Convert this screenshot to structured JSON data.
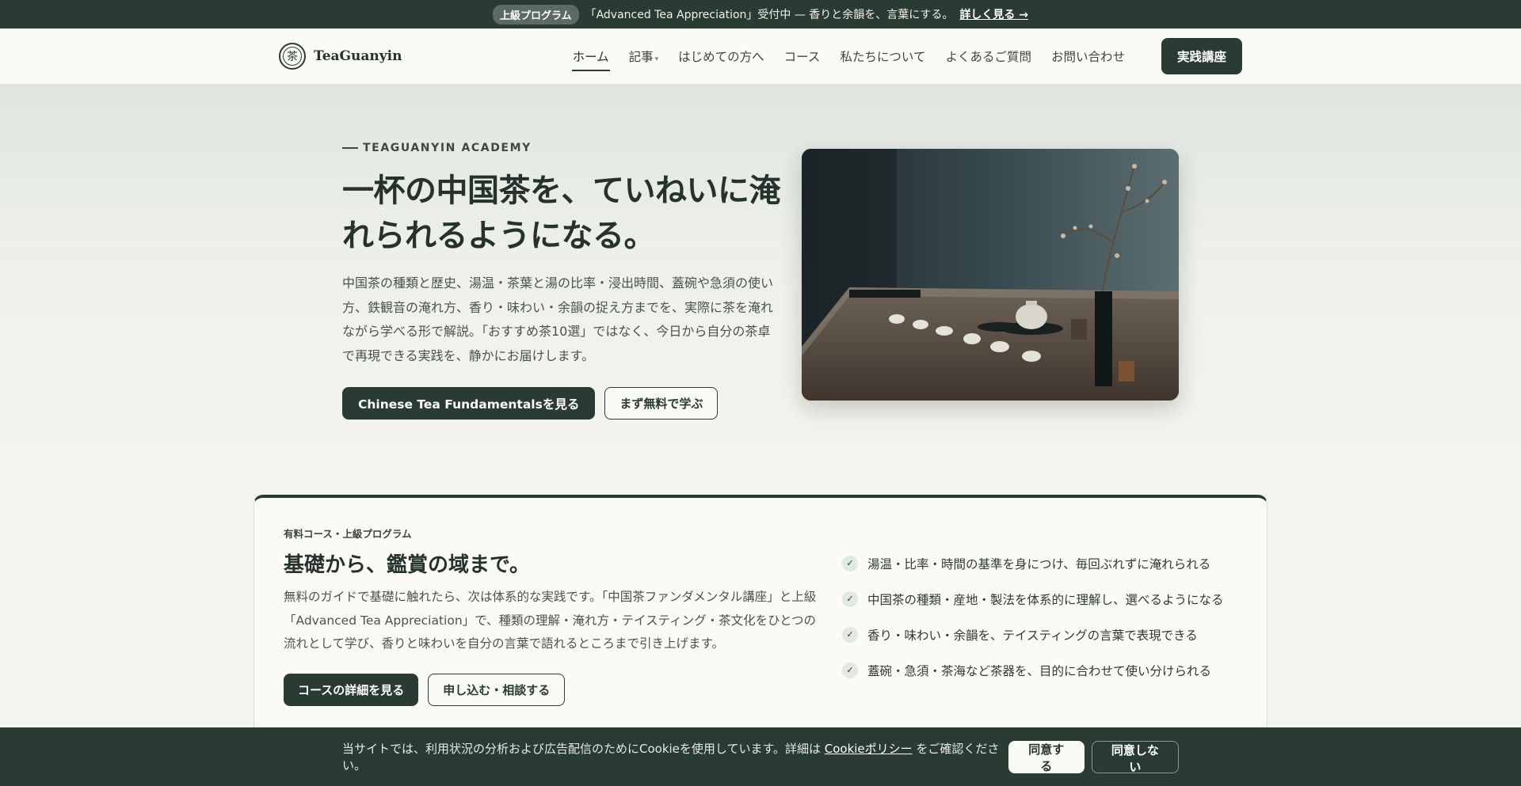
{
  "announcement": {
    "badge": "上級プログラム",
    "text": "「Advanced Tea Appreciation」受付中 — 香りと余韻を、言葉にする。",
    "link": "詳しく見る →"
  },
  "header": {
    "logo_mark": "茶",
    "logo_text": "TeaGuanyin",
    "nav": [
      {
        "label": "ホーム",
        "active": true
      },
      {
        "label": "記事",
        "caret": "▾"
      },
      {
        "label": "はじめての方へ"
      },
      {
        "label": "コース"
      },
      {
        "label": "私たちについて"
      },
      {
        "label": "よくあるご質問"
      },
      {
        "label": "お問い合わせ"
      }
    ],
    "cta": "実践講座"
  },
  "hero": {
    "eyebrow": "TEAGUANYIN ACADEMY",
    "title": "一杯の中国茶を、ていねいに淹れられるようになる。",
    "description": "中国茶の種類と歴史、湯温・茶葉と湯の比率・浸出時間、蓋碗や急須の使い方、鉄観音の淹れ方、香り・味わい・余韻の捉え方までを、実際に茶を淹れながら学べる形で解説。「おすすめ茶10選」ではなく、今日から自分の茶卓で再現できる実践を、静かにお届けします。",
    "primary_button": "Chinese Tea Fundamentalsを見る",
    "secondary_button": "まず無料で学ぶ",
    "image_icon": "tea-table-photo"
  },
  "course": {
    "eyebrow": "有料コース・上級プログラム",
    "title": "基礎から、鑑賞の域まで。",
    "description": "無料のガイドで基礎に触れたら、次は体系的な実践です。「中国茶ファンダメンタル講座」と上級「Advanced Tea Appreciation」で、種類の理解・淹れ方・テイスティング・茶文化をひとつの流れとして学び、香りと味わいを自分の言葉で語れるところまで引き上げます。",
    "primary_button": "コースの詳細を見る",
    "secondary_button": "申し込む・相談する",
    "features": [
      "湯温・比率・時間の基準を身につけ、毎回ぶれずに淹れられる",
      "中国茶の種類・産地・製法を体系的に理解し、選べるようになる",
      "香り・味わい・余韻を、テイスティングの言葉で表現できる",
      "蓋碗・急須・茶海など茶器を、目的に合わせて使い分けられる"
    ],
    "check_glyph": "✓"
  },
  "cookie": {
    "text_before": "当サイトでは、利用状況の分析および広告配信のためにCookieを使用しています。詳細は ",
    "policy_link": "Cookieポリシー",
    "text_after": " をご確認ください。",
    "accept": "同意する",
    "decline": "同意しない"
  }
}
